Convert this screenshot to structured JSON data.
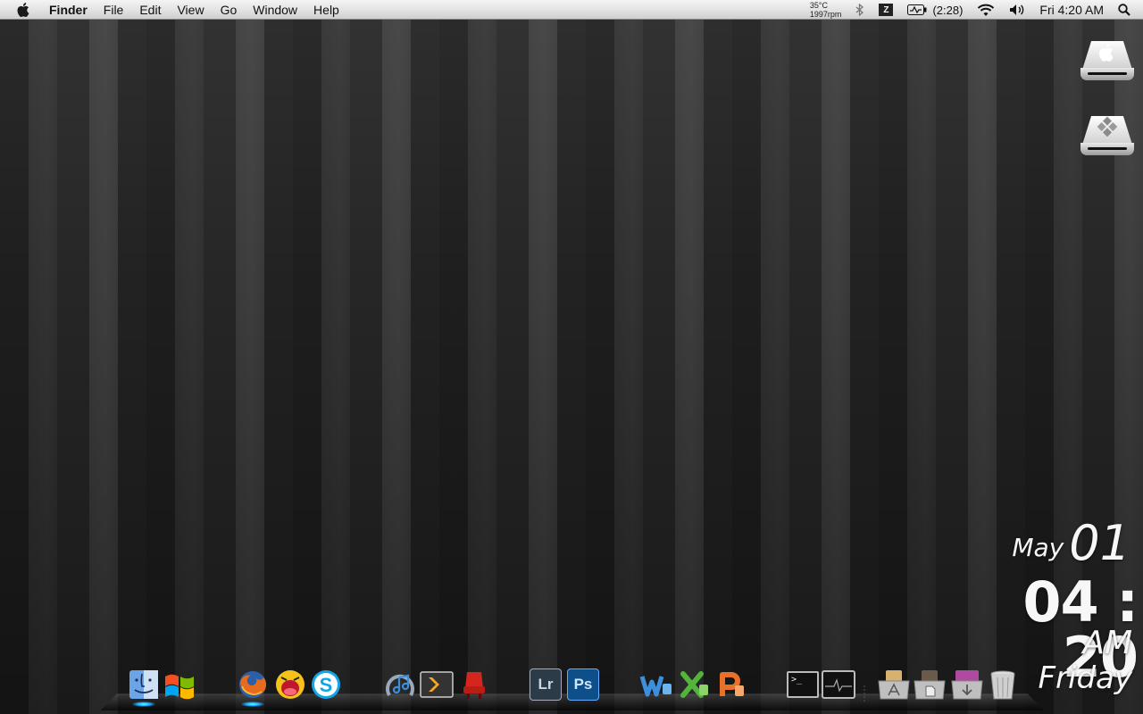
{
  "menubar": {
    "apple_icon": "apple-icon",
    "app_name": "Finder",
    "menus": [
      "File",
      "Edit",
      "View",
      "Go",
      "Window",
      "Help"
    ],
    "temperature": "35°C",
    "fan_speed": "1997rpm",
    "battery_time": "(2:28)",
    "clock": "Fri 4:20 AM",
    "status_icons": [
      "bluetooth-icon",
      "input-menu-icon",
      "battery-icon",
      "wifi-icon",
      "volume-icon",
      "spotlight-icon"
    ]
  },
  "desktop": {
    "drives": [
      {
        "icon": "apple-logo-icon"
      },
      {
        "icon": "windows-logo-icon"
      }
    ]
  },
  "clock_widget": {
    "month": "May",
    "day": "01",
    "time": "04 : 20",
    "ampm": "AM",
    "weekday": "Friday"
  },
  "dock": {
    "items": [
      {
        "icon": "finder-icon",
        "running": true
      },
      {
        "icon": "windows-icon",
        "running": false
      },
      {
        "icon": "firefox-icon",
        "running": true
      },
      {
        "icon": "adium-icon",
        "running": false
      },
      {
        "icon": "skype-icon",
        "running": false
      },
      {
        "icon": "itunes-icon",
        "running": false
      },
      {
        "icon": "plex-icon",
        "running": false
      },
      {
        "icon": "front-row-icon",
        "running": false
      },
      {
        "icon": "lightroom-icon",
        "label": "Lr",
        "running": false
      },
      {
        "icon": "photoshop-icon",
        "label": "Ps",
        "running": false
      },
      {
        "icon": "word-icon",
        "running": false
      },
      {
        "icon": "excel-icon",
        "running": false
      },
      {
        "icon": "powerpoint-icon",
        "running": false
      },
      {
        "icon": "terminal-icon",
        "label": ">_",
        "running": false
      },
      {
        "icon": "activity-monitor-icon",
        "running": false
      },
      {
        "icon": "applications-stack-icon",
        "running": false
      },
      {
        "icon": "documents-stack-icon",
        "running": false
      },
      {
        "icon": "downloads-stack-icon",
        "running": false
      },
      {
        "icon": "trash-icon",
        "running": false
      }
    ]
  }
}
